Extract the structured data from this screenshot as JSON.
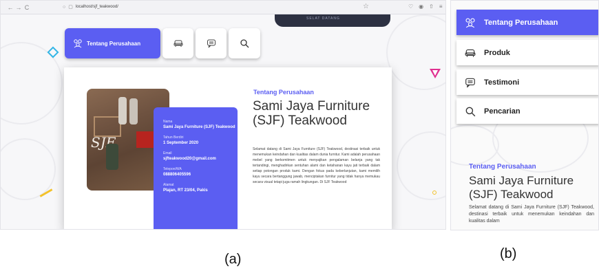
{
  "browser": {
    "url": "localhost/sjf_teakwood/",
    "back_icon": "back-arrow-icon",
    "forward_icon": "forward-arrow-icon",
    "reload_icon": "reload-icon"
  },
  "banner_text": "SELAT DATANG",
  "colors": {
    "accent": "#5b5ef2",
    "dark": "#2d3142",
    "decor_cyan": "#33b6e6",
    "decor_pink": "#e03090",
    "decor_yellow": "#f3c12a"
  },
  "nav_a": {
    "active_label": "Tentang Perusahaan",
    "icons": [
      "company-icon",
      "sofa-icon",
      "chat-icon",
      "search-icon"
    ]
  },
  "company_a": {
    "section_label": "Tentang Perusahaan",
    "title": "Sami Jaya Furniture (SJF) Teakwood",
    "paragraph": "Selamat datang di Sami Jaya Furniture (SJF) Teakwood, destinasi terbaik untuk menemukan keindahan dan kualitas dalam dunia furnitur. Kami adalah perusahaan mebel yang berkomitmen untuk menyajikan pengalaman belanja yang tak tertandingi, menghadirkan sentuhan alami dan ketahanan kayu jati terbaik dalam setiap potongan produk kami. Dengan fokus pada keberlanjutan, kami memilih kayu secara bertanggung jawab, menciptakan furnitur yang tidak hanya memukau secara visual tetapi juga ramah lingkungan. Di SJF Teakwood"
  },
  "info_card": {
    "name_label": "Nama",
    "name_value": "Sami Jaya Furniture (SJF) Teakwood",
    "year_label": "Tahun Berdiri",
    "year_value": "1 September 2020",
    "email_label": "Email",
    "email_value": "sjfteakwood20@gmail.com",
    "phone_label": "Telepon/WA",
    "phone_value": "088806405596",
    "address_label": "Alamat",
    "address_value": "Plajan, RT 23/04, Pakis"
  },
  "nav_b": {
    "items": [
      {
        "label": "Tentang Perusahaan",
        "icon": "company-icon"
      },
      {
        "label": "Produk",
        "icon": "sofa-icon"
      },
      {
        "label": "Testimoni",
        "icon": "chat-icon"
      },
      {
        "label": "Pencarian",
        "icon": "search-icon"
      }
    ]
  },
  "company_b": {
    "section_label": "Tentang Perusahaan",
    "title": "Sami Jaya Furniture (SJF) Teakwood",
    "paragraph": "Selamat datang di Sami Jaya Furniture (SJF) Teakwood, destinasi terbaik untuk menemukan keindahan dan kualitas dalam"
  },
  "captions": {
    "a": "(a)",
    "b": "(b)"
  }
}
